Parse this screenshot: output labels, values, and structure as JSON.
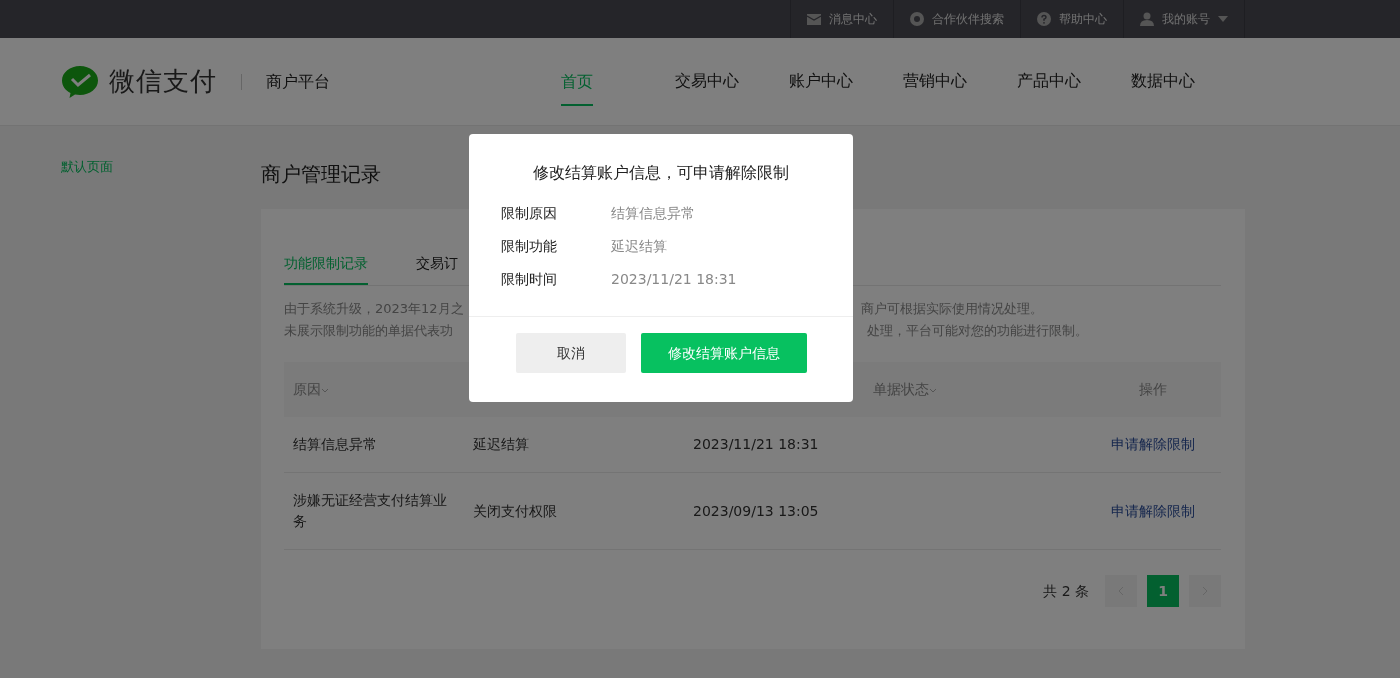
{
  "top_bar": {
    "links": [
      {
        "kind": "mail",
        "label": "消息中心"
      },
      {
        "kind": "partner",
        "label": "合作伙伴搜索"
      },
      {
        "kind": "help",
        "label": "帮助中心"
      },
      {
        "kind": "account",
        "label": "我的账号"
      }
    ]
  },
  "header": {
    "brand": "微信支付",
    "platform": "商户平台",
    "nav": [
      {
        "label": "首页",
        "selected": true
      },
      {
        "label": "交易中心",
        "selected": false
      },
      {
        "label": "账户中心",
        "selected": false
      },
      {
        "label": "营销中心",
        "selected": false
      },
      {
        "label": "产品中心",
        "selected": false
      },
      {
        "label": "数据中心",
        "selected": false
      }
    ]
  },
  "sidebar": {
    "items": [
      {
        "label": "默认页面"
      }
    ]
  },
  "page": {
    "title": "商户管理记录",
    "tabs": [
      {
        "label": "功能限制记录",
        "selected": true
      },
      {
        "label": "交易订",
        "selected": false
      }
    ],
    "notice": [
      {
        "left": "由于系统升级，2023年12月之",
        "right": "商户可根据实际使用情况处理。"
      },
      {
        "left": "未展示限制功能的单据代表功",
        "right": "处理，平台可能对您的功能进行限制。"
      }
    ],
    "table": {
      "columns": [
        {
          "label": "原因",
          "sortable": true
        },
        {
          "label": "单据状态",
          "sortable": true
        },
        {
          "label": "操作",
          "sortable": false
        }
      ],
      "rows": [
        {
          "reason": "结算信息异常",
          "function": "延迟结算",
          "time": "2023/11/21 18:31",
          "action": "申请解除限制"
        },
        {
          "reason": "涉嫌无证经营支付结算业务",
          "function": "关闭支付权限",
          "time": "2023/09/13 13:05",
          "action": "申请解除限制"
        }
      ]
    },
    "pagination": {
      "total": "共 2 条",
      "pages": [
        {
          "label": "1",
          "selected": true
        }
      ]
    }
  },
  "dialog": {
    "title": "修改结算账户信息，可申请解除限制",
    "fields": [
      {
        "label": "限制原因",
        "value": "结算信息异常"
      },
      {
        "label": "限制功能",
        "value": "延迟结算"
      },
      {
        "label": "限制时间",
        "value": "2023/11/21 18:31"
      }
    ],
    "buttons": [
      {
        "kind": "secondary",
        "label": "取消"
      },
      {
        "kind": "primary",
        "label": "修改结算账户信息"
      }
    ]
  }
}
